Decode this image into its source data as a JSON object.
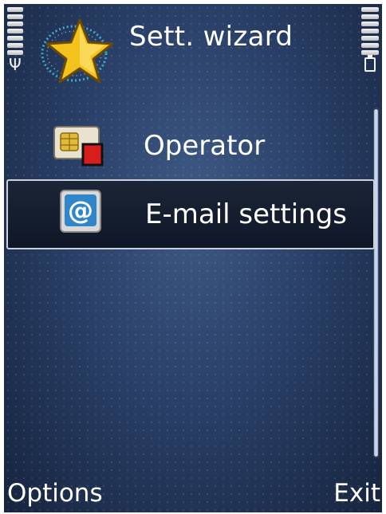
{
  "app": {
    "title": "Sett. wizard"
  },
  "status": {
    "signal_icon": "signal-antenna-icon",
    "battery_icon": "battery-icon"
  },
  "list": {
    "items": [
      {
        "label": "Operator",
        "icon": "sim-card-icon",
        "selected": false
      },
      {
        "label": "E-mail settings",
        "icon": "email-at-icon",
        "selected": true
      }
    ]
  },
  "softkeys": {
    "left": "Options",
    "right": "Exit"
  },
  "colors": {
    "accent_highlight": "#0f1727",
    "text": "#ffffff",
    "background": "#2a4068"
  }
}
